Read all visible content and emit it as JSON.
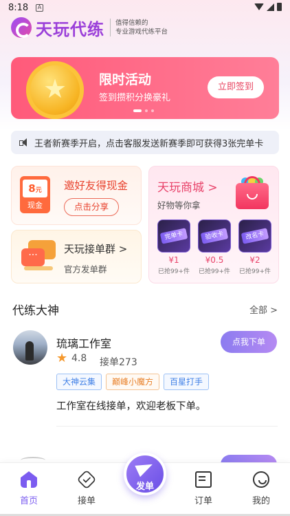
{
  "status_bar": {
    "time": "8:18",
    "notif_letter": "A"
  },
  "header": {
    "brand": "天玩代练",
    "slogan_line1": "值得信赖的",
    "slogan_line2": "专业游戏代练平台"
  },
  "banner": {
    "title": "限时活动",
    "subtitle": "签到攒积分换豪礼",
    "button": "立即签到"
  },
  "notice": {
    "text": "王者新赛季开启，点击客服发送新赛季即可获得3张完单卡"
  },
  "invite_card": {
    "title": "邀好友得现金",
    "amount": "8",
    "unit": "元",
    "cash_label": "现金",
    "button": "点击分享"
  },
  "group_card": {
    "title": "天玩接单群 >",
    "subtitle": "官方发单群",
    "bubble": "···"
  },
  "shop_card": {
    "title": "天玩商城 >",
    "subtitle": "好物等你拿",
    "products": [
      {
        "label": "完单卡",
        "price": "¥1",
        "sold": "已抢99+件"
      },
      {
        "label": "验收卡",
        "price": "¥0.5",
        "sold": "已抢99+件"
      },
      {
        "label": "改名卡",
        "price": "¥2",
        "sold": "已抢99+件"
      }
    ]
  },
  "section": {
    "title": "代练大神",
    "more": "全部 >"
  },
  "studio": {
    "name": "琉璃工作室",
    "rating": "4.8",
    "orders": "接单273",
    "button": "点我下单",
    "tags": [
      "大神云集",
      "巅峰小魔方",
      "百星打手"
    ],
    "description": "工作室在线接单，欢迎老板下单。"
  },
  "tabbar": {
    "home": "首页",
    "take": "接单",
    "post": "发单",
    "orders": "订单",
    "me": "我的"
  },
  "colors": {
    "accent": "#7b5cf0",
    "banner": "#ff5a7a",
    "brand": "#9a3fd9"
  }
}
